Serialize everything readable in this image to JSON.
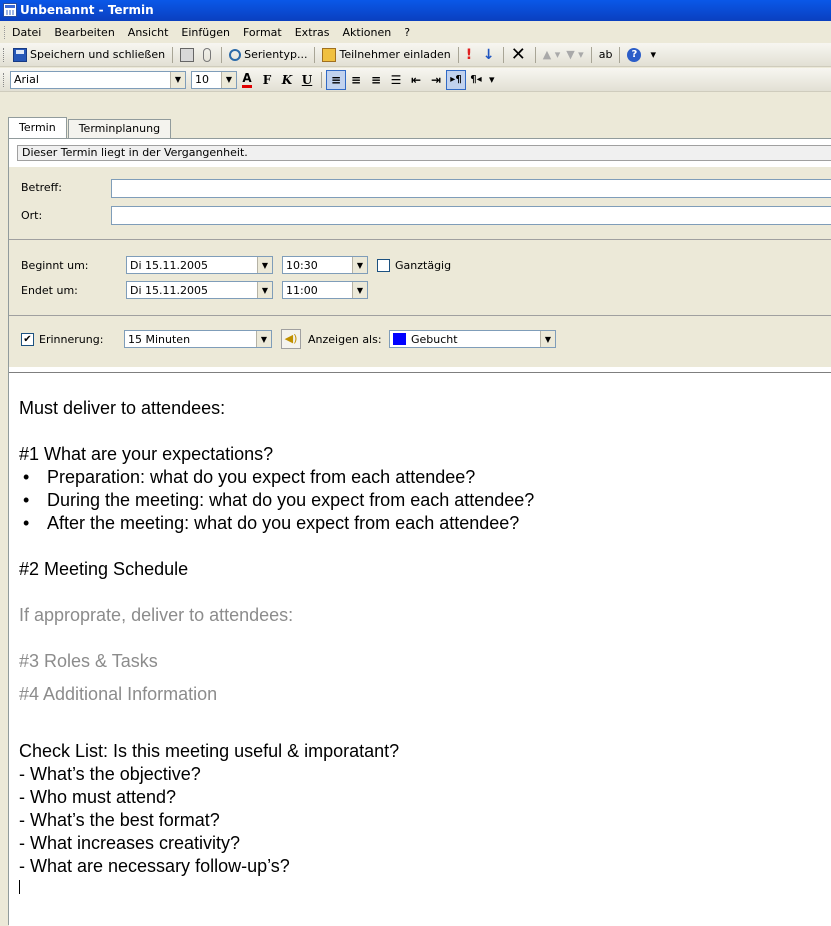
{
  "window": {
    "title": "Unbenannt - Termin"
  },
  "menu": [
    "Datei",
    "Bearbeiten",
    "Ansicht",
    "Einfügen",
    "Format",
    "Extras",
    "Aktionen",
    "?"
  ],
  "toolbar": {
    "save_close": "Speichern und schließen",
    "recurrence": "Serientyp...",
    "invite": "Teilnehmer einladen"
  },
  "format_bar": {
    "font": "Arial",
    "size": "10"
  },
  "tabs": [
    "Termin",
    "Terminplanung"
  ],
  "info_bar": "Dieser Termin liegt in der Vergangenheit.",
  "form": {
    "subject_label": "Betreff:",
    "subject_value": "",
    "location_label": "Ort:",
    "location_value": "",
    "start_label": "Beginnt um:",
    "start_date": "Di 15.11.2005",
    "start_time": "10:30",
    "allday_label": "Ganztägig",
    "end_label": "Endet um:",
    "end_date": "Di 15.11.2005",
    "end_time": "11:00",
    "reminder_label": "Erinnerung:",
    "reminder_value": "15 Minuten",
    "show_as_label": "Anzeigen als:",
    "show_as_value": "Gebucht",
    "show_as_color": "#0000ff"
  },
  "body": {
    "heading1": "Must deliver to attendees:",
    "item1_title": "#1 What are your expectations?",
    "item1_bullets": [
      "Preparation: what do you expect from each attendee?",
      "During the meeting: what do you expect from each attendee?",
      "After the meeting: what do you expect from each attendee?"
    ],
    "item2_title": "#2 Meeting Schedule",
    "heading2": "If approprate, deliver to attendees:",
    "item3_title": "#3 Roles & Tasks",
    "item4_title": "#4 Additional Information",
    "checklist_title": "Check List: Is this meeting useful & imporatant?",
    "checklist": [
      "- What’s the objective?",
      "- Who must attend?",
      "- What’s the best format?",
      "- What increases creativity?",
      "- What are necessary follow-up’s?"
    ]
  }
}
